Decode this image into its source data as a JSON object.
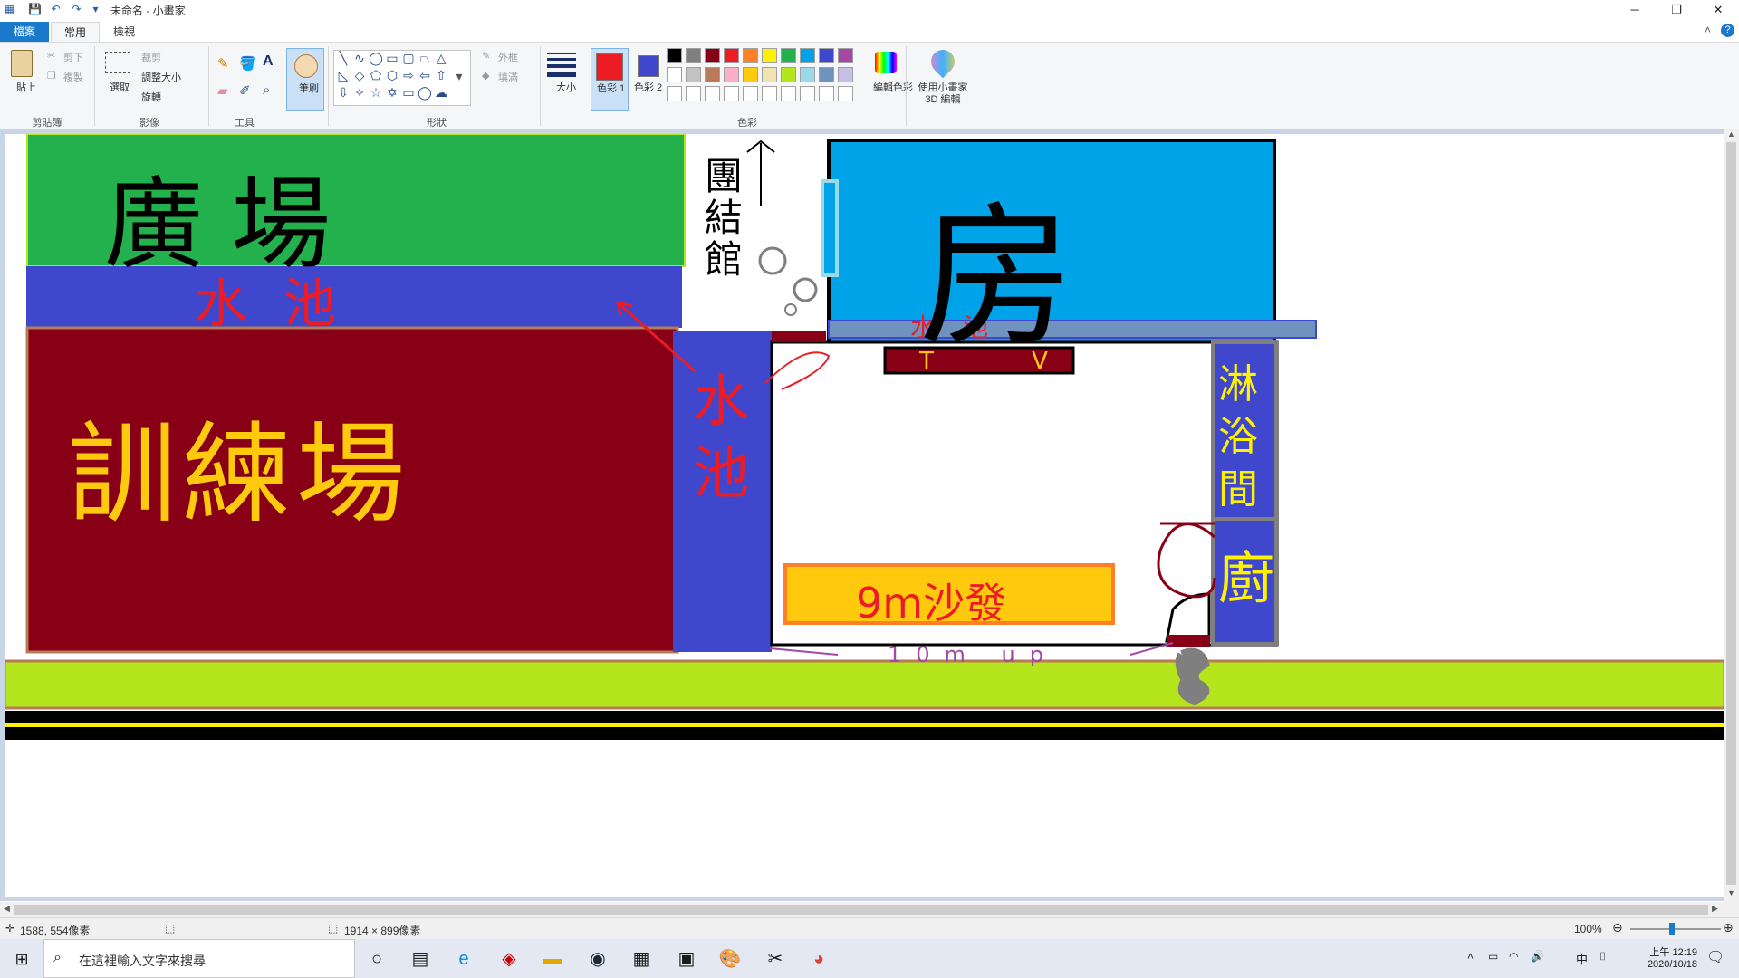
{
  "window": {
    "title": "未命名 - 小畫家",
    "controls": [
      "─",
      "❐",
      "✕"
    ]
  },
  "tabs": [
    {
      "label": "檔案"
    },
    {
      "label": "常用"
    },
    {
      "label": "檢視"
    }
  ],
  "ribbon": {
    "clipboard": {
      "paste": "貼上",
      "cut": "剪下",
      "copy": "複製",
      "group": "剪貼簿"
    },
    "image": {
      "select": "選取",
      "crop": "裁剪",
      "resize": "調整大小",
      "rotate": "旋轉",
      "group": "影像"
    },
    "tools": {
      "group": "工具"
    },
    "brush": {
      "label": "筆刷"
    },
    "shapes": {
      "outline": "外框",
      "fill": "填滿",
      "group": "形狀"
    },
    "size": {
      "label": "大小"
    },
    "color1": {
      "label": "色彩 1",
      "value": "#ed1c24"
    },
    "color2": {
      "label": "色彩 2",
      "value": "#3f48cc"
    },
    "palette": {
      "row1": [
        "#000000",
        "#7f7f7f",
        "#880015",
        "#ed1c24",
        "#ff7f27",
        "#fff200",
        "#22b14c",
        "#00a2e8",
        "#3f48cc",
        "#a349a4"
      ],
      "row2": [
        "#ffffff",
        "#c3c3c3",
        "#b97a57",
        "#ffaec9",
        "#ffc90e",
        "#efe4b0",
        "#b5e61d",
        "#99d9ea",
        "#7092be",
        "#c8bfe7"
      ],
      "row3": [
        "#ffffff",
        "#ffffff",
        "#ffffff",
        "#ffffff",
        "#ffffff",
        "#ffffff",
        "#ffffff",
        "#ffffff",
        "#ffffff",
        "#ffffff"
      ]
    },
    "edit_colors": "編輯色彩",
    "paint3d": "使用小畫家 3D 編輯",
    "colors_group": "色彩"
  },
  "drawing": {
    "plaza": "廣場",
    "pool_top": "水池",
    "training": "訓練場",
    "pool_side": "水池",
    "pool_right": "水池",
    "gate": "團結館",
    "house": "房",
    "tv": "T V",
    "sofa": "9m沙發",
    "shower": "淋浴間",
    "kitchen": "廚",
    "bottom_note": "10m up",
    "colors": {
      "plaza": "#22b14c",
      "pool": "#3f48cc",
      "training": "#880015",
      "house": "#00a2e8",
      "sofa": "#ffc90e",
      "grass": "#b5e61d"
    }
  },
  "status": {
    "cursor": "1588, 554像素",
    "size": "1914 × 899像素",
    "zoom": "100%"
  },
  "taskbar": {
    "search_placeholder": "在這裡輸入文字來搜尋",
    "ime": "中",
    "time": "上午 12:19",
    "date": "2020/10/18"
  }
}
